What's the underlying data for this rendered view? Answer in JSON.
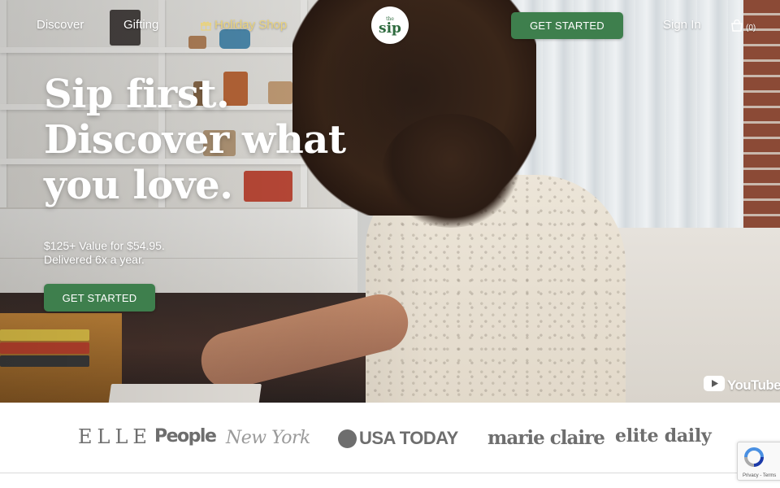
{
  "nav": {
    "discover": "Discover",
    "gifting": "Gifting",
    "holiday_shop": "Holiday Shop",
    "cta": "GET STARTED",
    "sign_in": "Sign In",
    "cart_count": "(0)"
  },
  "logo": {
    "the": "the",
    "name": "sip"
  },
  "hero": {
    "headline_line1": "Sip first.",
    "headline_line2": "Discover what",
    "headline_line3": "you love.",
    "subcopy_line1": "$125+ Value for $54.95.",
    "subcopy_line2": "Delivered 6x a year.",
    "cta": "GET STARTED"
  },
  "video": {
    "provider": "YouTube"
  },
  "press": {
    "logos": [
      "ELLE",
      "People",
      "New York",
      "USA TODAY",
      "marie claire",
      "elite daily"
    ]
  },
  "recaptcha": {
    "links": "Privacy - Terms"
  },
  "colors": {
    "brand_green": "#3e7f4d",
    "holiday_gold": "#e9d27c",
    "press_gray": "#6e6e6e"
  },
  "icons": [
    "gift-icon",
    "cart-icon",
    "youtube-play-icon",
    "recaptcha-icon"
  ]
}
